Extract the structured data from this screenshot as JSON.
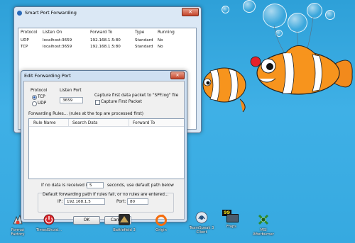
{
  "spf_window": {
    "title": "Smart Port Forwarding",
    "close_glyph": "✕",
    "columns": [
      "Protocol",
      "Listen On",
      "Forward To",
      "Type",
      "Running"
    ],
    "rows": [
      [
        "UDP",
        "localhost:3659",
        "192.168.1.5:80",
        "Standard",
        "No"
      ],
      [
        "TCP",
        "localhost:3659",
        "192.168.1.5:80",
        "Standard",
        "No"
      ]
    ]
  },
  "edit_dialog": {
    "title": "Edit Forwarding Port",
    "close_glyph": "✕",
    "protocol_label": "Protocol",
    "protocol_tcp": "TCP",
    "protocol_udp": "UDP",
    "listen_port_label": "Listen Port",
    "listen_port_value": "3659",
    "capture_note": "Capture first data packet to \"SPF.log\" file",
    "capture_checkbox_label": "Capture First Packet",
    "rules_label": "Forwarding Rules... (rules at the top are processed first)",
    "rules_columns": [
      "Rule Name",
      "Search Data",
      "Forward To"
    ],
    "timeout_prefix": "If no data is received in",
    "timeout_value": "5",
    "timeout_suffix": "seconds, use default path below",
    "default_path_label": "Default forwarding path if rules fail, or no rules are entered...",
    "ip_label": "IP:",
    "ip_value": "192.168.1.5",
    "port_label": "Port:",
    "port_value": "80",
    "ok_label": "OK",
    "cancel_label": "Cancel"
  },
  "desktop_icons": [
    {
      "label": "Format\nFactory",
      "icon": "format-factory-icon"
    },
    {
      "label": "TimedShutd...",
      "icon": "timed-shutdown-icon"
    },
    {
      "label": "Battlefield 3",
      "icon": "battlefield-icon"
    },
    {
      "label": "Origin",
      "icon": "origin-icon"
    },
    {
      "label": "TeamSpeak 3\nClient",
      "icon": "teamspeak-icon"
    },
    {
      "label": "Fraps",
      "icon": "fraps-icon"
    },
    {
      "label": "MSI\nAfterburner",
      "icon": "msi-afterburner-icon"
    }
  ],
  "fraps_badge": "99"
}
